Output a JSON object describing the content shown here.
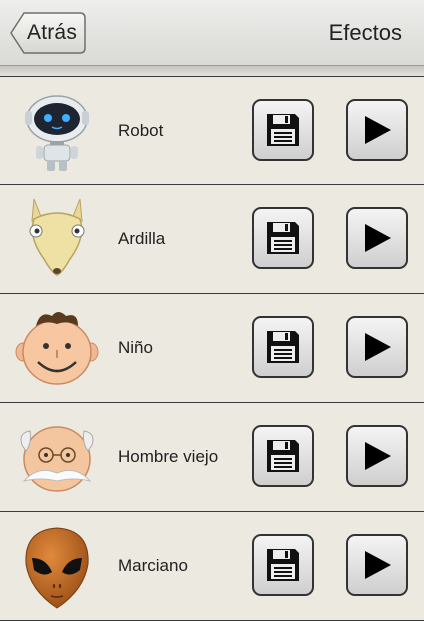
{
  "header": {
    "back_label": "Atrás",
    "title": "Efectos"
  },
  "effects": [
    {
      "label": "Robot",
      "icon": "robot-icon"
    },
    {
      "label": "Ardilla",
      "icon": "squirrel-icon"
    },
    {
      "label": "Niño",
      "icon": "boy-face-icon"
    },
    {
      "label": "Hombre viejo",
      "icon": "old-man-face-icon"
    },
    {
      "label": "Marciano",
      "icon": "alien-face-icon"
    }
  ],
  "buttons": {
    "save_icon": "floppy-disk-icon",
    "play_icon": "play-icon"
  }
}
